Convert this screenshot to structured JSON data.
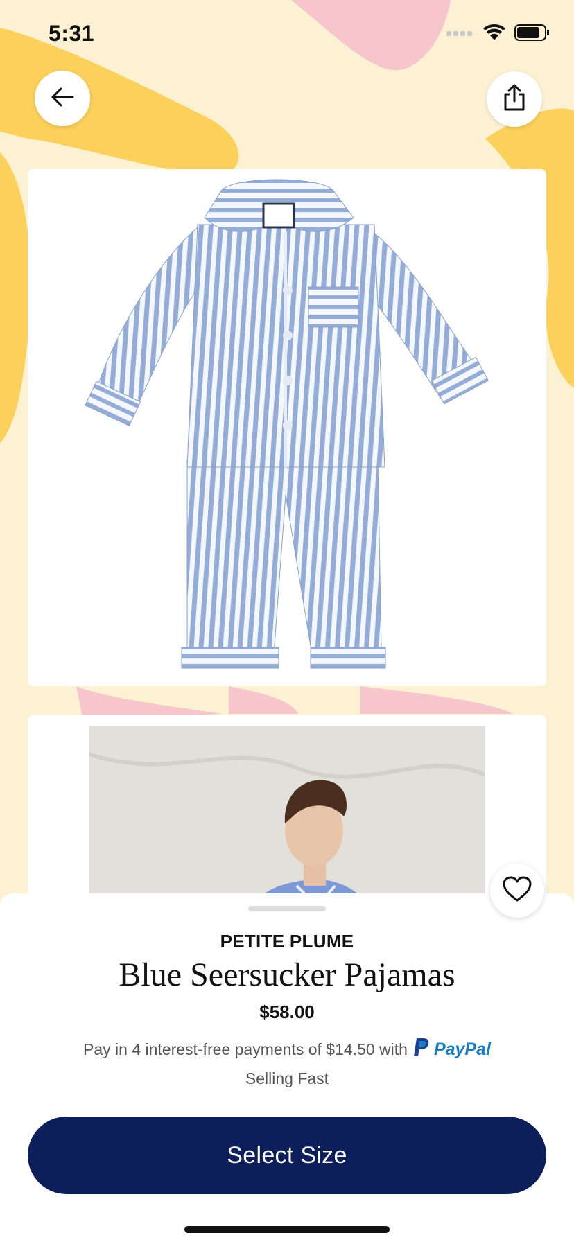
{
  "status_bar": {
    "time": "5:31"
  },
  "nav": {
    "back_icon": "arrow-left-icon",
    "share_icon": "share-icon"
  },
  "product": {
    "brand": "PETITE PLUME",
    "title": "Blue Seersucker Pajamas",
    "price": "$58.00",
    "installments_text": "Pay in 4 interest-free payments of $14.50 with",
    "payment_provider": "PayPal",
    "availability": "Selling Fast",
    "favorite_icon": "heart-icon"
  },
  "actions": {
    "select_size_label": "Select Size"
  },
  "colors": {
    "cta": "#0c1f5b",
    "paypal": "#1a7cc3",
    "background": "#fdf1d3"
  }
}
